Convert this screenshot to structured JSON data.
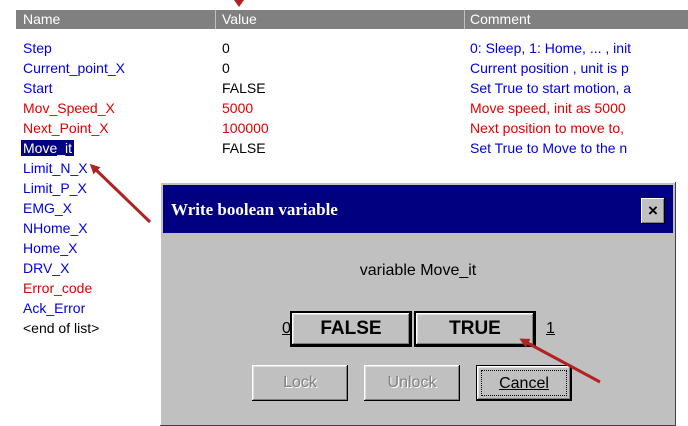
{
  "colors": {
    "header_bg": "#808080",
    "selected_bg": "#000080",
    "title_bar": "#000080",
    "dialog_bg": "#c0c0c0",
    "arrow": "#b22222"
  },
  "columns": [
    "Name",
    "Value",
    "Comment"
  ],
  "rows": [
    {
      "name": "Step",
      "value": "0",
      "comment": "0: Sleep, 1: Home, ... , init",
      "color": "blue"
    },
    {
      "name": "Current_point_X",
      "value": "0",
      "comment": "Current position , unit is p",
      "color": "blue"
    },
    {
      "name": "Start",
      "value": "FALSE",
      "comment": "Set True to start motion, a",
      "color": "blue"
    },
    {
      "name": "Mov_Speed_X",
      "value": "5000",
      "comment": "Move speed, init as 5000",
      "color": "red"
    },
    {
      "name": "Next_Point_X",
      "value": "100000",
      "comment": "Next position to move to,",
      "color": "red"
    },
    {
      "name": "Move_it",
      "value": "FALSE",
      "comment": "Set True to Move to the n",
      "color": "blue",
      "selected": true
    },
    {
      "name": "Limit_N_X",
      "value": "",
      "comment": "",
      "color": "blue"
    },
    {
      "name": "Limit_P_X",
      "value": "",
      "comment": "",
      "color": "blue"
    },
    {
      "name": "EMG_X",
      "value": "",
      "comment": "",
      "color": "blue"
    },
    {
      "name": "NHome_X",
      "value": "",
      "comment": "",
      "color": "blue"
    },
    {
      "name": "Home_X",
      "value": "",
      "comment": "",
      "color": "blue"
    },
    {
      "name": "DRV_X",
      "value": "",
      "comment": "",
      "color": "blue"
    },
    {
      "name": "Error_code",
      "value": "",
      "comment": "",
      "color": "red"
    },
    {
      "name": "Ack_Error",
      "value": "",
      "comment": "",
      "color": "blue"
    },
    {
      "name": "<end of list>",
      "value": "",
      "comment": "",
      "color": "black"
    }
  ],
  "dialog": {
    "title": "Write boolean variable",
    "close_label": "×",
    "variable_text": "variable Move_it",
    "label_zero": "0",
    "label_one": "1",
    "false_label": "FALSE",
    "true_label": "TRUE",
    "lock_label": "Lock",
    "unlock_label": "Unlock",
    "cancel_label": "Cancel"
  }
}
